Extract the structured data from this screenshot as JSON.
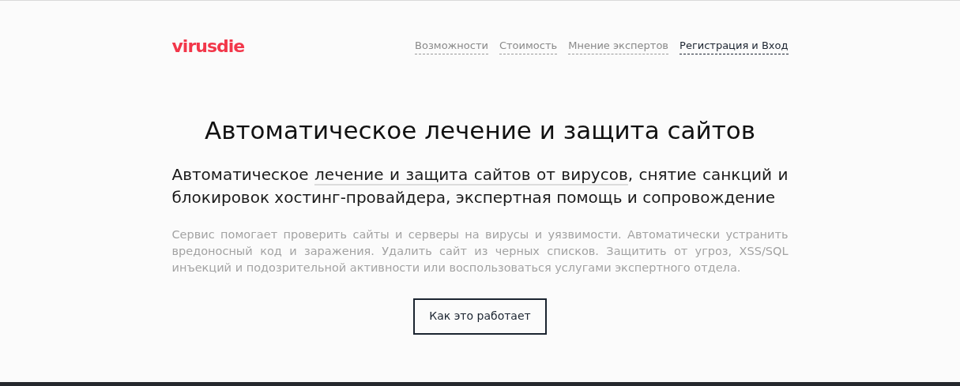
{
  "logo": "virusdie",
  "nav": [
    {
      "label": "Возможности",
      "selected": false
    },
    {
      "label": "Стоимость",
      "selected": false
    },
    {
      "label": "Мнение экспертов",
      "selected": false
    },
    {
      "label": "Регистрация и Вход",
      "selected": true
    }
  ],
  "title": "Автоматическое лечение и защита сайтов",
  "subtitle": [
    {
      "kind": "text",
      "text": "Автоматическое "
    },
    {
      "kind": "link",
      "text": "лечение и защита сайтов от вирусов"
    },
    {
      "kind": "text",
      "text": ", снятие санкций и блокировок хостинг-провайдера, экспертная помощь и сопровождение"
    }
  ],
  "description": "Сервис помогает проверить сайты и серверы на вирусы и уязвимости. Автоматически устранить вредоносный код и заражения. Удалить сайт из черных списков. Защитить от угроз, XSS/SQL инъекций и подозрительной активности или воспользоваться услугами экспертного отдела.",
  "button": "Как это работает"
}
